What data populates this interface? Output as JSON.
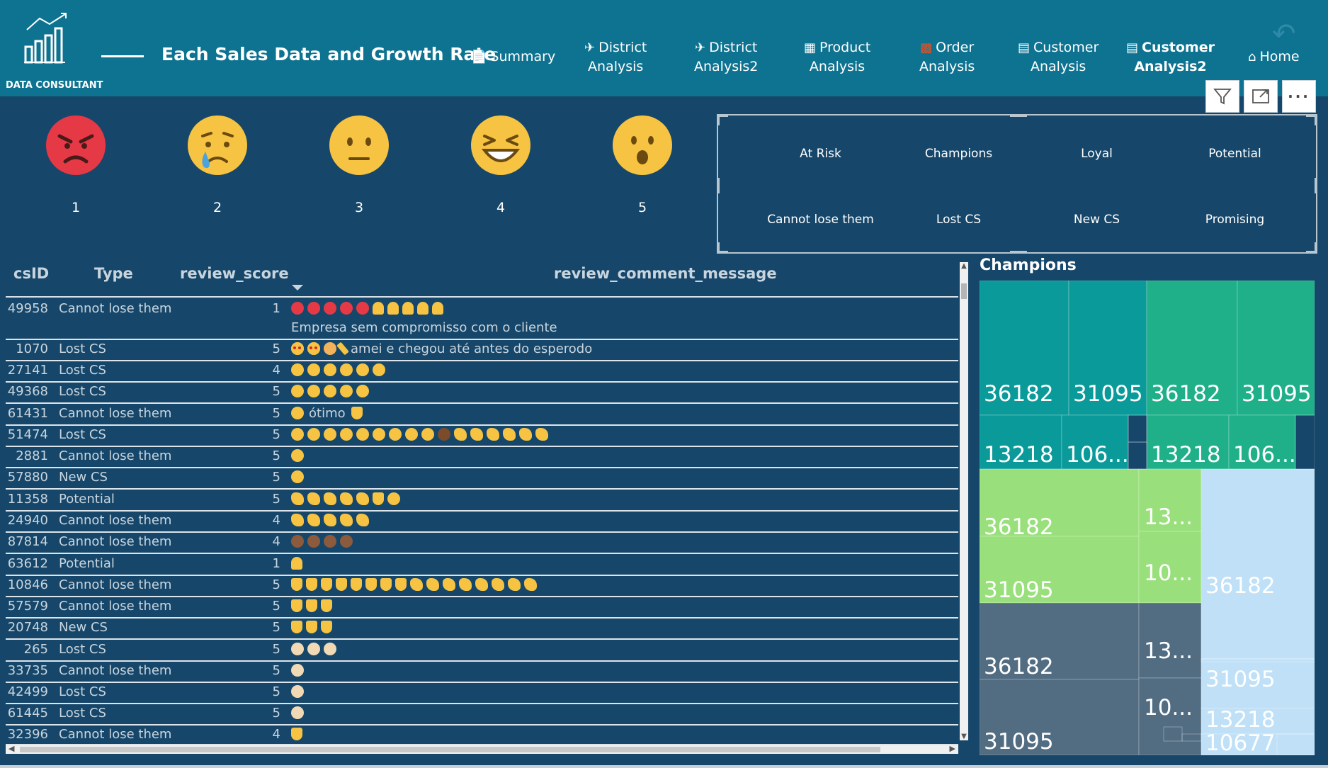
{
  "header": {
    "logo_text": "DATA CONSULTANT",
    "title": "Each Sales Data and Growth Rate",
    "nav": [
      {
        "line1": "Summary",
        "line2": "",
        "icon": "document-icon",
        "active": false
      },
      {
        "line1": "District",
        "line2": "Analysis",
        "icon": "map-icon",
        "active": false
      },
      {
        "line1": "District",
        "line2": "Analysis2",
        "icon": "map-icon",
        "active": false
      },
      {
        "line1": "Product",
        "line2": "Analysis",
        "icon": "box-icon",
        "active": false
      },
      {
        "line1": "Order",
        "line2": "Analysis",
        "icon": "truck-icon",
        "active": false
      },
      {
        "line1": "Customer",
        "line2": "Analysis",
        "icon": "chat-icon",
        "active": false
      },
      {
        "line1": "Customer",
        "line2": "Analysis2",
        "icon": "chat-icon",
        "active": true
      },
      {
        "line1": "Home",
        "line2": "",
        "icon": "home-icon",
        "active": false
      }
    ]
  },
  "emoji_scores": [
    {
      "label": "1",
      "face": "angry"
    },
    {
      "label": "2",
      "face": "crying"
    },
    {
      "label": "3",
      "face": "neutral"
    },
    {
      "label": "4",
      "face": "laughing"
    },
    {
      "label": "5",
      "face": "surprised"
    }
  ],
  "slicer": {
    "items": [
      "At Risk",
      "Champions",
      "Loyal",
      "Potential",
      "Cannot lose them",
      "Lost CS",
      "New CS",
      "Promising"
    ]
  },
  "table": {
    "columns": [
      "csID",
      "Type",
      "review_score",
      "review_comment_message"
    ],
    "rows": [
      {
        "id": "49958",
        "type": "Cannot lose them",
        "score": "1",
        "glyphs": "red red red red red th-dn th-dn th-dn th-dn th-dn",
        "text": "",
        "text2": "Empresa sem compromisso com o cliente"
      },
      {
        "id": "1070",
        "type": "Lost CS",
        "score": "5",
        "glyphs": "heart heart woman pencil",
        "text": "amei e chegou até antes do esperodo",
        "text2": ""
      },
      {
        "id": "27141",
        "type": "Lost CS",
        "score": "4",
        "glyphs": "yel yel yel yel yel yel",
        "text": "",
        "text2": ""
      },
      {
        "id": "49368",
        "type": "Lost CS",
        "score": "5",
        "glyphs": "yel yel yel yel yel",
        "text": "",
        "text2": ""
      },
      {
        "id": "61431",
        "type": "Cannot lose them",
        "score": "5",
        "glyphs": "yel",
        "text": "ótimo",
        "text2": "",
        "tail": "th-up"
      },
      {
        "id": "51474",
        "type": "Lost CS",
        "score": "5",
        "glyphs": "yel yel yel yel yel yel yel yel yel bird clap clap clap clap clap clap",
        "text": "",
        "text2": ""
      },
      {
        "id": "2881",
        "type": "Cannot lose them",
        "score": "5",
        "glyphs": "yel",
        "text": "",
        "text2": ""
      },
      {
        "id": "57880",
        "type": "New CS",
        "score": "5",
        "glyphs": "yel",
        "text": "",
        "text2": ""
      },
      {
        "id": "11358",
        "type": "Potential",
        "score": "5",
        "glyphs": "clap clap clap clap clap th-up yel",
        "text": "",
        "text2": ""
      },
      {
        "id": "24940",
        "type": "Cannot lose them",
        "score": "4",
        "glyphs": "clap clap clap clap clap",
        "text": "",
        "text2": ""
      },
      {
        "id": "87814",
        "type": "Cannot lose them",
        "score": "4",
        "glyphs": "brn brn brn brn",
        "text": "",
        "text2": ""
      },
      {
        "id": "63612",
        "type": "Potential",
        "score": "1",
        "glyphs": "th-dn",
        "text": "",
        "text2": ""
      },
      {
        "id": "10846",
        "type": "Cannot lose them",
        "score": "5",
        "glyphs": "th-up th-up th-up th-up th-up th-up th-up th-up clap clap clap clap clap clap clap clap",
        "text": "",
        "text2": ""
      },
      {
        "id": "57579",
        "type": "Cannot lose them",
        "score": "5",
        "glyphs": "th-up th-up th-up",
        "text": "",
        "text2": ""
      },
      {
        "id": "20748",
        "type": "New CS",
        "score": "5",
        "glyphs": "th-up th-up th-up",
        "text": "",
        "text2": ""
      },
      {
        "id": "265",
        "type": "Lost CS",
        "score": "5",
        "glyphs": "wht wht wht",
        "text": "",
        "text2": ""
      },
      {
        "id": "33735",
        "type": "Cannot lose them",
        "score": "5",
        "glyphs": "wht",
        "text": "",
        "text2": ""
      },
      {
        "id": "42499",
        "type": "Lost CS",
        "score": "5",
        "glyphs": "wht",
        "text": "",
        "text2": ""
      },
      {
        "id": "61445",
        "type": "Lost CS",
        "score": "5",
        "glyphs": "wht",
        "text": "",
        "text2": ""
      },
      {
        "id": "32396",
        "type": "Cannot lose them",
        "score": "4",
        "glyphs": "th-up",
        "text": "",
        "text2": ""
      }
    ]
  },
  "treemap": {
    "title": "Champions",
    "cells": [
      "36182",
      "31095",
      "36182",
      "31095",
      "13218",
      "106...",
      "13218",
      "106...",
      "36182",
      "31095",
      "13...",
      "10...",
      "36182",
      "31095",
      "13...",
      "10...",
      "36182",
      "31095",
      "13218",
      "10677"
    ],
    "colors": {
      "teal_dark": "#0b9a9a",
      "teal_mid": "#1fb08a",
      "green": "#99e07c",
      "slate": "#526d82",
      "light_blue": "#bfe0f6"
    }
  },
  "colors": {
    "header_bg": "#0e7391",
    "page_bg": "#16476a"
  }
}
